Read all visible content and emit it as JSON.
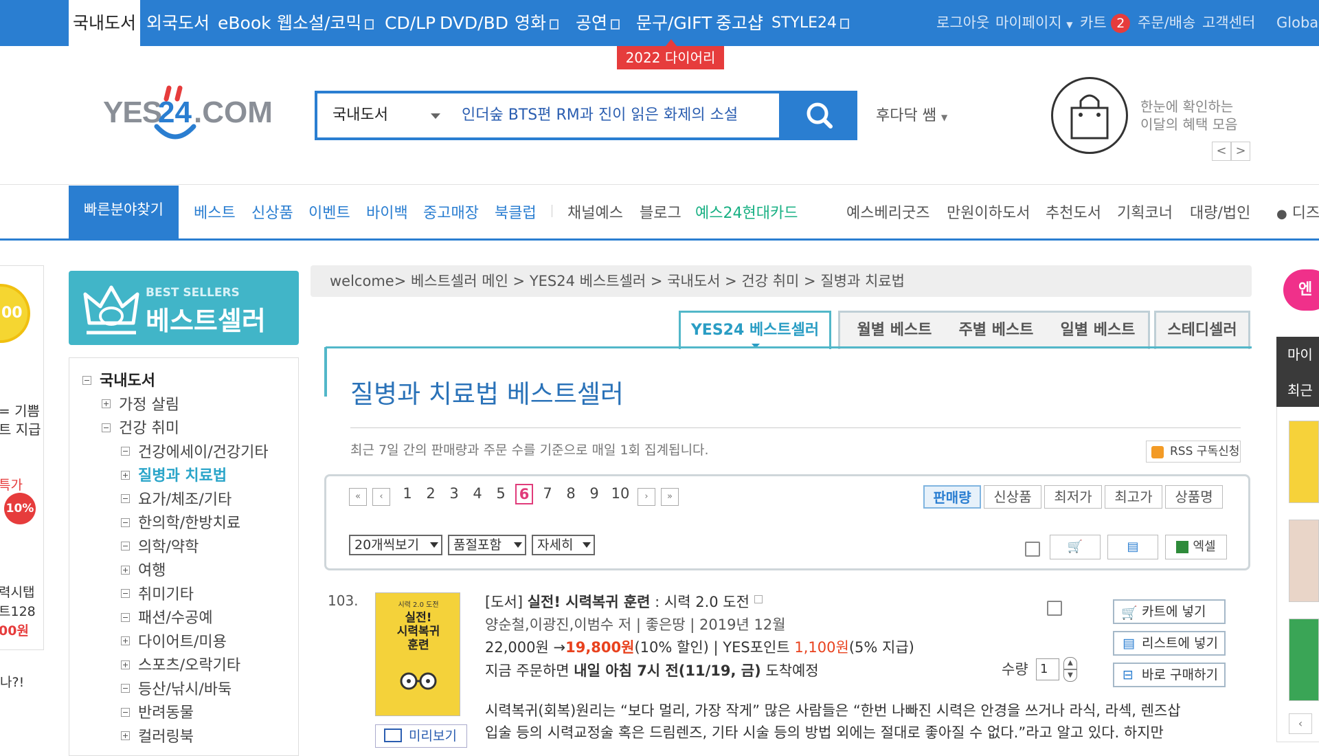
{
  "topnav": {
    "items": [
      "국내도서",
      "외국도서",
      "eBook",
      "웹소설/코믹",
      "CD/LP",
      "DVD/BD",
      "영화",
      "공연",
      "문구/GIFT",
      "중고샵",
      "STYLE24"
    ],
    "utility": {
      "logout": "로그아웃",
      "mypage": "마이페이지",
      "cart": "카트",
      "cart_count": "2",
      "orders": "주문/배송",
      "cs": "고객센터",
      "global": "Global"
    },
    "promo": "2022 다이어리"
  },
  "header": {
    "logo_text": "YES24.COM",
    "search_category": "국내도서",
    "search_value": "인더숲 BTS편 RM과 진이 읽은 화제의 소설",
    "user": "후다닥 쌤",
    "benefit_line1": "한눈에 확인하는",
    "benefit_line2": "이달의 혜택 모음",
    "prev": "<",
    "next": ">"
  },
  "catnav": {
    "quick": "빠른분야찾기",
    "items_blue": [
      "베스트",
      "신상품",
      "이벤트",
      "바이백",
      "중고매장",
      "북클럽"
    ],
    "items_gray": [
      "채널예스",
      "블로그"
    ],
    "item_green": "예스24현대카드",
    "items_right": [
      "예스베리굿즈",
      "만원이하도서",
      "추천도서",
      "기획코너",
      "대량/법인"
    ],
    "edge": "디즈"
  },
  "left_edge": {
    "t1": "= 기쁨",
    "t2": "트 지급",
    "t3": "특가",
    "discount": "10%",
    "t4": "력시탭",
    "t5": "트128",
    "t6": "00원",
    "t7": "나?!",
    "coin": "00"
  },
  "sidebar": {
    "banner_small": "BEST SELLERS",
    "banner_big": "베스트셀러",
    "tree": [
      {
        "label": "국내도서",
        "level": 0,
        "icon": "minus",
        "style": "bold"
      },
      {
        "label": "가정 살림",
        "level": 1,
        "icon": "plus",
        "style": ""
      },
      {
        "label": "건강 취미",
        "level": 1,
        "icon": "minus",
        "style": ""
      },
      {
        "label": "건강에세이/건강기타",
        "level": 2,
        "icon": "minus",
        "style": ""
      },
      {
        "label": "질병과 치료법",
        "level": 2,
        "icon": "plus",
        "style": "active"
      },
      {
        "label": "요가/체조/기타",
        "level": 2,
        "icon": "minus",
        "style": ""
      },
      {
        "label": "한의학/한방치료",
        "level": 2,
        "icon": "minus",
        "style": ""
      },
      {
        "label": "의학/약학",
        "level": 2,
        "icon": "minus",
        "style": ""
      },
      {
        "label": "여행",
        "level": 2,
        "icon": "plus",
        "style": ""
      },
      {
        "label": "취미기타",
        "level": 2,
        "icon": "minus",
        "style": ""
      },
      {
        "label": "패션/수공예",
        "level": 2,
        "icon": "minus",
        "style": ""
      },
      {
        "label": "다이어트/미용",
        "level": 2,
        "icon": "plus",
        "style": ""
      },
      {
        "label": "스포츠/오락기타",
        "level": 2,
        "icon": "plus",
        "style": ""
      },
      {
        "label": "등산/낚시/바둑",
        "level": 2,
        "icon": "minus",
        "style": ""
      },
      {
        "label": "반려동물",
        "level": 2,
        "icon": "minus",
        "style": ""
      },
      {
        "label": "컬러링북",
        "level": 2,
        "icon": "plus",
        "style": ""
      }
    ]
  },
  "breadcrumb": "welcome> 베스트셀러 메인 > YES24 베스트셀러 > 국내도서 > 건강 취미 > 질병과 치료법",
  "tabs": [
    "YES24 베스트셀러",
    "월별 베스트",
    "주별 베스트",
    "일별 베스트",
    "스테디셀러"
  ],
  "main": {
    "title": "질병과 치료법 베스트셀러",
    "desc": "최근 7일 간의 판매량과 주문 수를 기준으로 매일 1회 집계됩니다.",
    "rss": "RSS 구독신청"
  },
  "pagination": {
    "pages": [
      "1",
      "2",
      "3",
      "4",
      "5",
      "6",
      "7",
      "8",
      "9",
      "10"
    ],
    "current": "6",
    "first": "«",
    "prev": "‹",
    "next": "›",
    "last": "»"
  },
  "sort": [
    "판매량",
    "신상품",
    "최저가",
    "최고가",
    "상품명"
  ],
  "view": {
    "per_page": "20개씩보기",
    "soldout": "품절포함",
    "detail": "자세히",
    "excel": "엑셀"
  },
  "item": {
    "rank": "103.",
    "category": "[도서]",
    "title": "실전! 시력복귀 훈련",
    "subtitle": ": 시력 2.0 도전",
    "meta": "양순철,이광진,이범수 저 | 좋은땅 | 2019년 12월",
    "price_orig": "22,000원",
    "arrow": "→",
    "price_sale": "19,800원",
    "discount": "(10% 할인)",
    "points_label": "| YES포인트",
    "points": "1,100원",
    "points_rate": "(5% 지급)",
    "delivery_pre": "지금 주문하면",
    "delivery_bold": "내일 아침 7시 전(11/19, 금)",
    "delivery_post": "도착예정",
    "desc1": "시력복귀(회복)원리는 “보다 멀리, 가장 작게” 많은 사람들은 “한번 나빠진 시력은 안경을 쓰거나 라식, 라섹, 렌즈삽",
    "desc2": "입술 등의 시력교정술 혹은 드림렌즈, 기타 시술 등의 방법 외에는 절대로 좋아질 수 없다.”라고 알고 있다. 하지만",
    "cover_top": "시력 2.0 도전",
    "cover_title1": "실전!",
    "cover_title2": "시력복귀",
    "cover_title3": "훈련",
    "preview": "미리보기",
    "qty_label": "수량",
    "qty": "1",
    "btn_cart": "카트에 넣기",
    "btn_list": "리스트에 넣기",
    "btn_buy": "바로 구매하기"
  },
  "right_edge": {
    "r1": "마이",
    "r2": "최근",
    "badge": "엔"
  },
  "colors": {
    "brand": "#2a7ed1",
    "teal": "#52b7c9",
    "sale": "#e8421e",
    "alert": "#e63c3c"
  }
}
